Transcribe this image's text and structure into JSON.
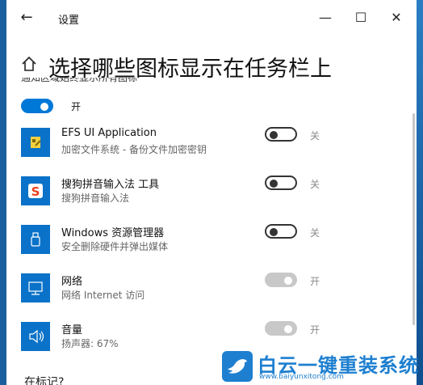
{
  "window": {
    "title": "设置",
    "minimize_glyph": "—",
    "maximize_glyph": "☐",
    "close_glyph": "✕",
    "back_glyph": "←"
  },
  "page": {
    "title": "选择哪些图标显示在任务栏上",
    "clipped_heading": "通知区域始终显示所有图标"
  },
  "master_toggle": {
    "state": "on",
    "label": "开"
  },
  "accent_color": "#0078d7",
  "rows": [
    {
      "icon": "efs-icon",
      "title": "EFS UI Application",
      "subtitle": "加密文件系统 - 备份文件加密密钥",
      "toggle": "off",
      "state_label": "关"
    },
    {
      "icon": "sogou-icon",
      "title": "搜狗拼音输入法 工具",
      "subtitle": "搜狗拼音输入法",
      "toggle": "off",
      "state_label": "关"
    },
    {
      "icon": "usb-icon",
      "title": "Windows 资源管理器",
      "subtitle": "安全删除硬件并弹出媒体",
      "toggle": "off",
      "state_label": "关"
    },
    {
      "icon": "network-icon",
      "title": "网络",
      "subtitle": "网络 Internet 访问",
      "toggle": "disabled-on",
      "state_label": "开"
    },
    {
      "icon": "volume-icon",
      "title": "音量",
      "subtitle": "扬声器: 67%",
      "toggle": "disabled-on",
      "state_label": "开"
    }
  ],
  "bottom_clipped": "在标记?",
  "watermark": {
    "name": "白云一键重装系统",
    "url": "www.baiyunxitong.com"
  }
}
